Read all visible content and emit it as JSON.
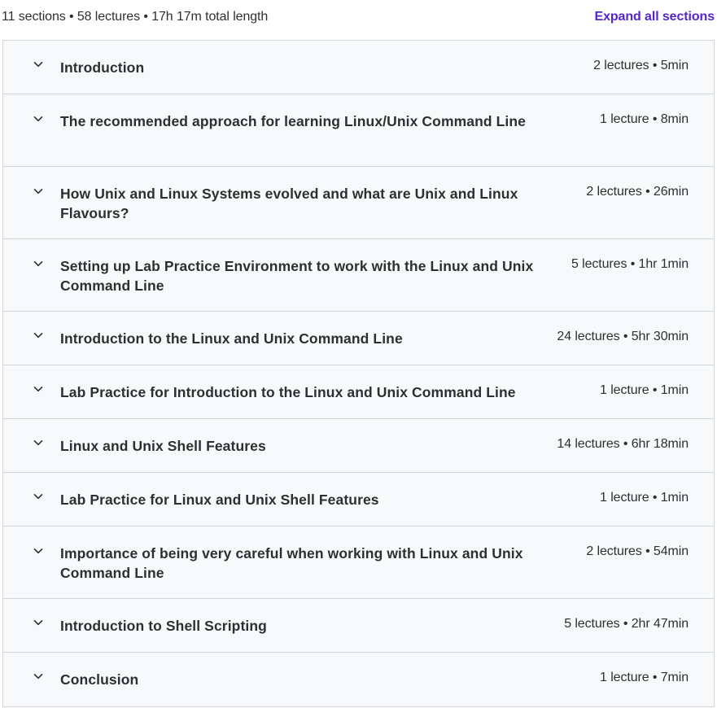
{
  "summary": "11 sections • 58 lectures • 17h 17m total length",
  "expand_all_label": "Expand all sections",
  "sections": [
    {
      "title": "Introduction",
      "meta": "2 lectures • 5min"
    },
    {
      "title": "The recommended approach for learning Linux/Unix Command Line",
      "meta": "1 lecture • 8min"
    },
    {
      "title": "How Unix and Linux Systems evolved and what are Unix and Linux Flavours?",
      "meta": "2 lectures • 26min"
    },
    {
      "title": "Setting up Lab Practice Environment to work with the Linux and Unix Command Line",
      "meta": "5 lectures • 1hr 1min"
    },
    {
      "title": "Introduction to the Linux and Unix Command Line",
      "meta": "24 lectures • 5hr 30min"
    },
    {
      "title": "Lab Practice for Introduction to the Linux and Unix Command Line",
      "meta": "1 lecture • 1min"
    },
    {
      "title": "Linux and Unix Shell Features",
      "meta": "14 lectures • 6hr 18min"
    },
    {
      "title": "Lab Practice for Linux and Unix Shell Features",
      "meta": "1 lecture • 1min"
    },
    {
      "title": "Importance of being very careful when working with Linux and Unix Command Line",
      "meta": "2 lectures • 54min"
    },
    {
      "title": "Introduction to Shell Scripting",
      "meta": "5 lectures • 2hr 47min"
    },
    {
      "title": "Conclusion",
      "meta": "1 lecture • 7min"
    }
  ],
  "colors": {
    "accent": "#5624d0",
    "text": "#2d2f31",
    "panel": "#f7f9fa",
    "border": "#d1d7dc"
  },
  "icons": {
    "section_toggle": "chevron-down-icon"
  }
}
